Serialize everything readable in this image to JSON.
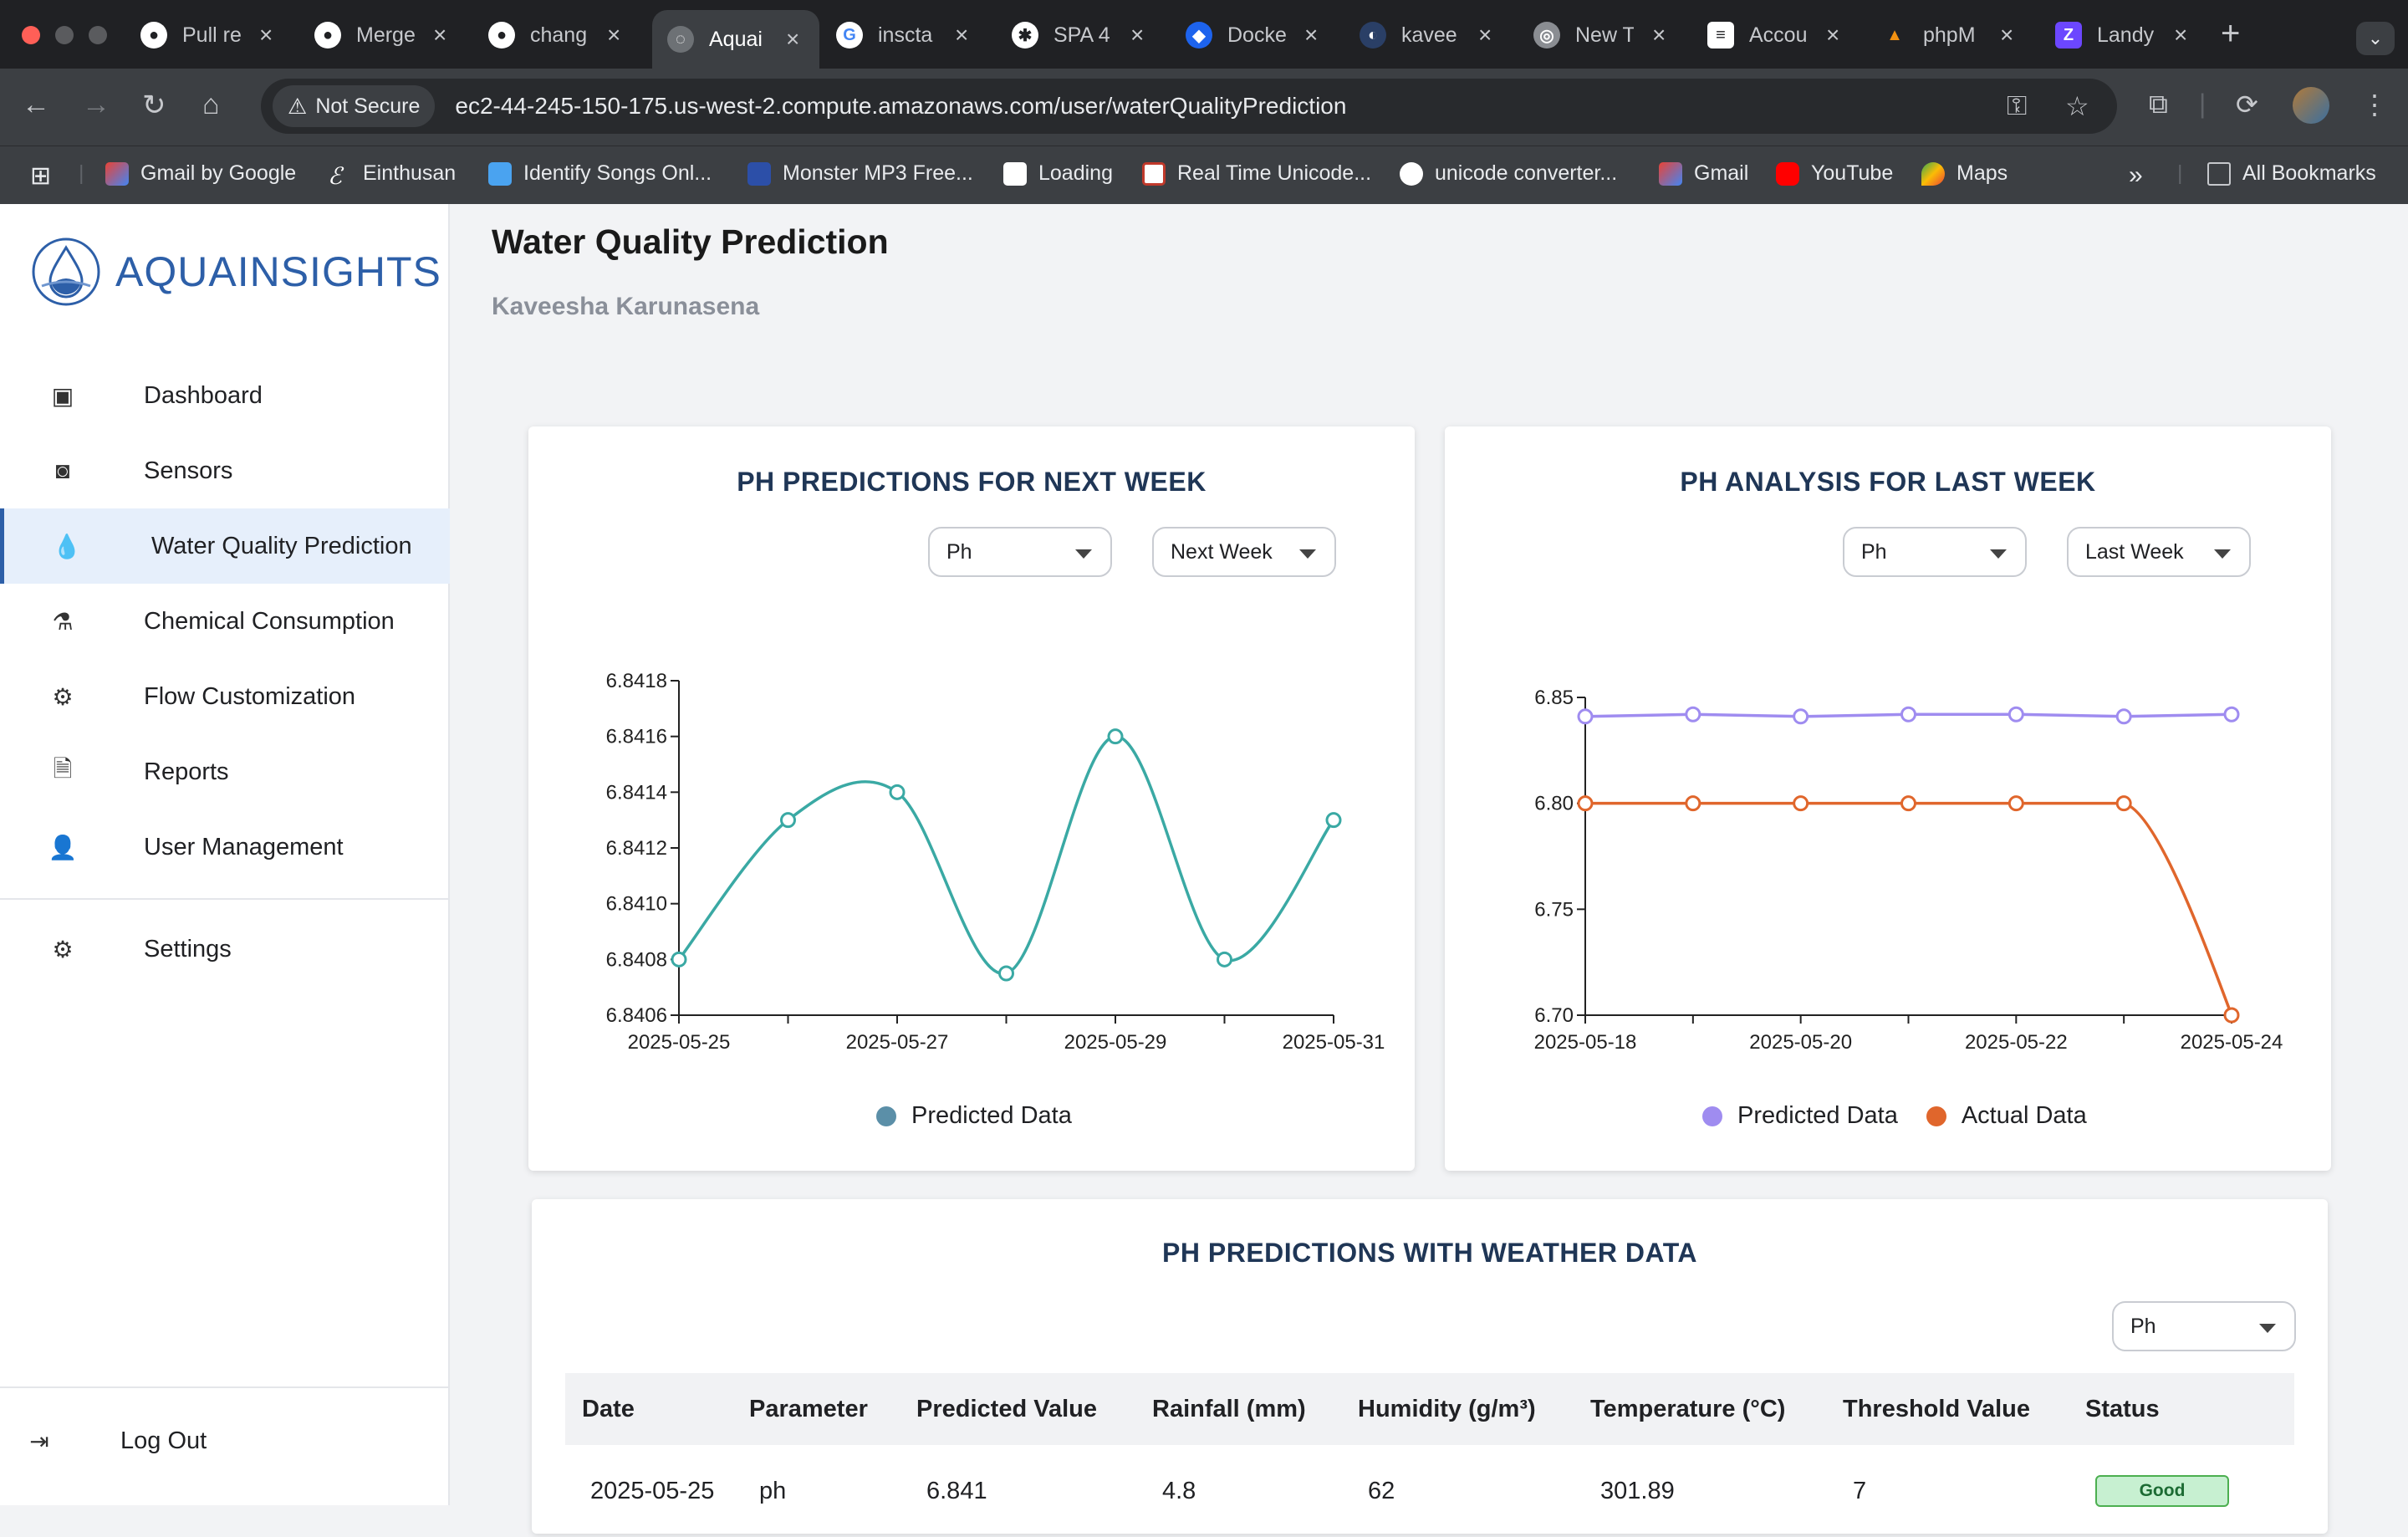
{
  "browser": {
    "tabs": [
      {
        "label": "Pull re",
        "icon": "github-icon"
      },
      {
        "label": "Merge",
        "icon": "github-merge-icon"
      },
      {
        "label": "chang",
        "icon": "github-icon"
      },
      {
        "label": "Aquai",
        "icon": "globe-icon"
      },
      {
        "label": "inscta",
        "icon": "google-icon"
      },
      {
        "label": "SPA 4",
        "icon": "openai-icon"
      },
      {
        "label": "Docke",
        "icon": "docker-icon"
      },
      {
        "label": "kavee",
        "icon": "app-icon"
      },
      {
        "label": "New T",
        "icon": "chrome-icon"
      },
      {
        "label": "Accou",
        "icon": "database-icon"
      },
      {
        "label": "phpM",
        "icon": "phpmyadmin-icon"
      },
      {
        "label": "Landy",
        "icon": "z-icon"
      }
    ],
    "not_secure": "Not Secure",
    "url": "ec2-44-245-150-175.us-west-2.compute.amazonaws.com/user/waterQualityPrediction",
    "bookmarks": [
      "Gmail by Google",
      "Einthusan",
      "Identify Songs Onl...",
      "Monster MP3 Free...",
      "Loading",
      "Real Time Unicode...",
      "unicode converter...",
      "Gmail",
      "YouTube",
      "Maps"
    ],
    "all_bookmarks": "All Bookmarks",
    "colors": {
      "chrome_dark": "#202124",
      "chrome_toolbar": "#3c3f43"
    }
  },
  "sidebar": {
    "brand": "AQUAINSIGHTS",
    "items": [
      {
        "label": "Dashboard",
        "icon": "chart-icon"
      },
      {
        "label": "Sensors",
        "icon": "sensor-icon"
      },
      {
        "label": "Water Quality Prediction",
        "icon": "droplet-icon"
      },
      {
        "label": "Chemical Consumption",
        "icon": "flask-icon"
      },
      {
        "label": "Flow Customization",
        "icon": "flow-icon"
      },
      {
        "label": "Reports",
        "icon": "report-icon"
      },
      {
        "label": "User Management",
        "icon": "user-icon"
      }
    ],
    "settings": "Settings",
    "logout": "Log Out",
    "colors": {
      "accent": "#2d5fa8",
      "active_bg": "#e6effb"
    }
  },
  "main": {
    "title": "Water Quality Prediction",
    "user": "Kaveesha Karunasena"
  },
  "chart_data": [
    {
      "type": "line",
      "title": "PH PREDICTIONS FOR NEXT WEEK",
      "parameter_select": "Ph",
      "period_select": "Next Week",
      "x": [
        "2025-05-25",
        "2025-05-26",
        "2025-05-27",
        "2025-05-28",
        "2025-05-29",
        "2025-05-30",
        "2025-05-31"
      ],
      "x_tick_labels": [
        "2025-05-25",
        "2025-05-27",
        "2025-05-29",
        "2025-05-31"
      ],
      "y_ticks": [
        "6.8406",
        "6.8408",
        "6.8410",
        "6.8412",
        "6.8414",
        "6.8416",
        "6.8418"
      ],
      "ylim": [
        6.8406,
        6.8418
      ],
      "series": [
        {
          "name": "Predicted Data",
          "color": "#3aa9a4",
          "values": [
            6.8408,
            6.8413,
            6.8414,
            6.84075,
            6.8416,
            6.8408,
            6.8413
          ]
        }
      ],
      "legend": [
        {
          "label": "Predicted Data",
          "color": "#5b8fa8"
        }
      ],
      "legend_position": "bottom",
      "grid": false
    },
    {
      "type": "line",
      "title": "PH ANALYSIS FOR LAST WEEK",
      "parameter_select": "Ph",
      "period_select": "Last Week",
      "x": [
        "2025-05-18",
        "2025-05-19",
        "2025-05-20",
        "2025-05-21",
        "2025-05-22",
        "2025-05-23",
        "2025-05-24"
      ],
      "x_tick_labels": [
        "2025-05-18",
        "2025-05-20",
        "2025-05-22",
        "2025-05-24"
      ],
      "y_ticks": [
        "6.70",
        "6.75",
        "6.80",
        "6.85"
      ],
      "ylim": [
        6.7,
        6.85
      ],
      "series": [
        {
          "name": "Predicted Data",
          "color": "#9f8cf0",
          "values": [
            6.841,
            6.842,
            6.841,
            6.842,
            6.842,
            6.841,
            6.842
          ]
        },
        {
          "name": "Actual Data",
          "color": "#e0662c",
          "values": [
            6.8,
            6.8,
            6.8,
            6.8,
            6.8,
            6.8,
            6.7
          ]
        }
      ],
      "legend": [
        {
          "label": "Predicted Data",
          "color": "#9f8cf0"
        },
        {
          "label": "Actual Data",
          "color": "#e0662c"
        }
      ],
      "legend_position": "bottom",
      "grid": false
    }
  ],
  "weather": {
    "title": "PH PREDICTIONS WITH WEATHER DATA",
    "select": "Ph",
    "columns": [
      "Date",
      "Parameter",
      "Predicted Value",
      "Rainfall (mm)",
      "Humidity (g/m³)",
      "Temperature (°C)",
      "Threshold Value",
      "Status"
    ],
    "rows": [
      [
        "2025-05-25",
        "ph",
        "6.841",
        "4.8",
        "62",
        "301.89",
        "7",
        "Good"
      ]
    ]
  }
}
